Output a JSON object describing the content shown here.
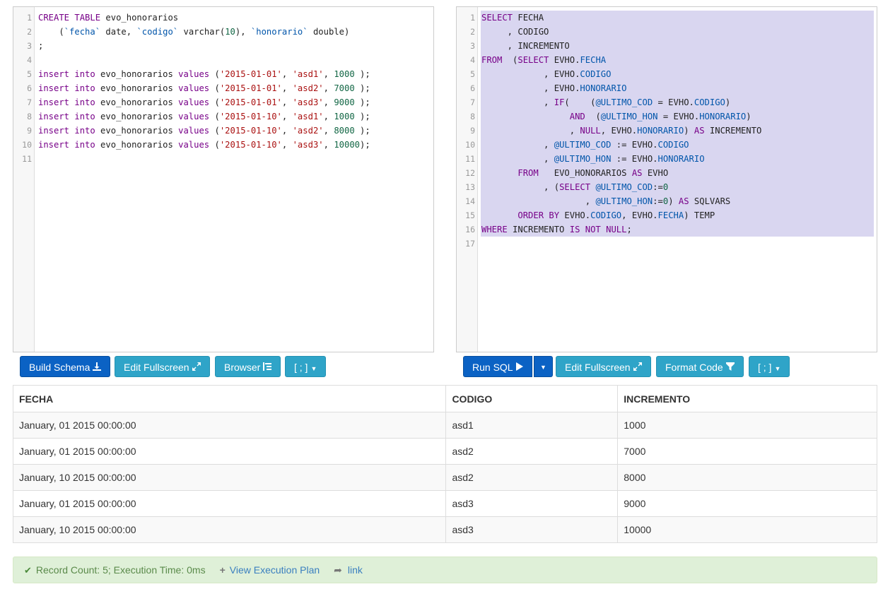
{
  "schema_editor": {
    "lines": [
      [
        {
          "t": "CREATE TABLE ",
          "c": "kw"
        },
        {
          "t": "evo_honorarios",
          "c": "plain"
        }
      ],
      [
        {
          "t": "    (",
          "c": "plain"
        },
        {
          "t": "`fecha`",
          "c": "bq"
        },
        {
          "t": " date, ",
          "c": "plain"
        },
        {
          "t": "`codigo`",
          "c": "bq"
        },
        {
          "t": " varchar(",
          "c": "plain"
        },
        {
          "t": "10",
          "c": "num"
        },
        {
          "t": "), ",
          "c": "plain"
        },
        {
          "t": "`honorario`",
          "c": "bq"
        },
        {
          "t": " double)",
          "c": "plain"
        }
      ],
      [
        {
          "t": ";",
          "c": "plain"
        }
      ],
      [],
      [
        {
          "t": "insert into",
          "c": "kw"
        },
        {
          "t": " evo_honorarios ",
          "c": "plain"
        },
        {
          "t": "values",
          "c": "kw"
        },
        {
          "t": " (",
          "c": "plain"
        },
        {
          "t": "'2015-01-01'",
          "c": "str"
        },
        {
          "t": ", ",
          "c": "plain"
        },
        {
          "t": "'asd1'",
          "c": "str"
        },
        {
          "t": ", ",
          "c": "plain"
        },
        {
          "t": "1000",
          "c": "num"
        },
        {
          "t": " );",
          "c": "plain"
        }
      ],
      [
        {
          "t": "insert into",
          "c": "kw"
        },
        {
          "t": " evo_honorarios ",
          "c": "plain"
        },
        {
          "t": "values",
          "c": "kw"
        },
        {
          "t": " (",
          "c": "plain"
        },
        {
          "t": "'2015-01-01'",
          "c": "str"
        },
        {
          "t": ", ",
          "c": "plain"
        },
        {
          "t": "'asd2'",
          "c": "str"
        },
        {
          "t": ", ",
          "c": "plain"
        },
        {
          "t": "7000",
          "c": "num"
        },
        {
          "t": " );",
          "c": "plain"
        }
      ],
      [
        {
          "t": "insert into",
          "c": "kw"
        },
        {
          "t": " evo_honorarios ",
          "c": "plain"
        },
        {
          "t": "values",
          "c": "kw"
        },
        {
          "t": " (",
          "c": "plain"
        },
        {
          "t": "'2015-01-01'",
          "c": "str"
        },
        {
          "t": ", ",
          "c": "plain"
        },
        {
          "t": "'asd3'",
          "c": "str"
        },
        {
          "t": ", ",
          "c": "plain"
        },
        {
          "t": "9000",
          "c": "num"
        },
        {
          "t": " );",
          "c": "plain"
        }
      ],
      [
        {
          "t": "insert into",
          "c": "kw"
        },
        {
          "t": " evo_honorarios ",
          "c": "plain"
        },
        {
          "t": "values",
          "c": "kw"
        },
        {
          "t": " (",
          "c": "plain"
        },
        {
          "t": "'2015-01-10'",
          "c": "str"
        },
        {
          "t": ", ",
          "c": "plain"
        },
        {
          "t": "'asd1'",
          "c": "str"
        },
        {
          "t": ", ",
          "c": "plain"
        },
        {
          "t": "1000",
          "c": "num"
        },
        {
          "t": " );",
          "c": "plain"
        }
      ],
      [
        {
          "t": "insert into",
          "c": "kw"
        },
        {
          "t": " evo_honorarios ",
          "c": "plain"
        },
        {
          "t": "values",
          "c": "kw"
        },
        {
          "t": " (",
          "c": "plain"
        },
        {
          "t": "'2015-01-10'",
          "c": "str"
        },
        {
          "t": ", ",
          "c": "plain"
        },
        {
          "t": "'asd2'",
          "c": "str"
        },
        {
          "t": ", ",
          "c": "plain"
        },
        {
          "t": "8000",
          "c": "num"
        },
        {
          "t": " );",
          "c": "plain"
        }
      ],
      [
        {
          "t": "insert into",
          "c": "kw"
        },
        {
          "t": " evo_honorarios ",
          "c": "plain"
        },
        {
          "t": "values",
          "c": "kw"
        },
        {
          "t": " (",
          "c": "plain"
        },
        {
          "t": "'2015-01-10'",
          "c": "str"
        },
        {
          "t": ", ",
          "c": "plain"
        },
        {
          "t": "'asd3'",
          "c": "str"
        },
        {
          "t": ", ",
          "c": "plain"
        },
        {
          "t": "10000",
          "c": "num"
        },
        {
          "t": ");",
          "c": "plain"
        }
      ],
      []
    ]
  },
  "query_editor": {
    "selected_lines": 16,
    "lines": [
      [
        {
          "t": "SELECT",
          "c": "kw"
        },
        {
          "t": " FECHA",
          "c": "plain"
        }
      ],
      [
        {
          "t": "     , CODIGO",
          "c": "plain"
        }
      ],
      [
        {
          "t": "     , INCREMENTO",
          "c": "plain"
        }
      ],
      [
        {
          "t": "FROM",
          "c": "kw"
        },
        {
          "t": "  (",
          "c": "plain"
        },
        {
          "t": "SELECT",
          "c": "kw"
        },
        {
          "t": " EVHO.",
          "c": "plain"
        },
        {
          "t": "FECHA",
          "c": "prop"
        }
      ],
      [
        {
          "t": "            , EVHO.",
          "c": "plain"
        },
        {
          "t": "CODIGO",
          "c": "prop"
        }
      ],
      [
        {
          "t": "            , EVHO.",
          "c": "plain"
        },
        {
          "t": "HONORARIO",
          "c": "prop"
        }
      ],
      [
        {
          "t": "            , ",
          "c": "plain"
        },
        {
          "t": "IF",
          "c": "kw"
        },
        {
          "t": "(    (",
          "c": "plain"
        },
        {
          "t": "@ULTIMO_COD",
          "c": "var"
        },
        {
          "t": " = EVHO.",
          "c": "plain"
        },
        {
          "t": "CODIGO",
          "c": "prop"
        },
        {
          "t": ")",
          "c": "plain"
        }
      ],
      [
        {
          "t": "                 ",
          "c": "plain"
        },
        {
          "t": "AND",
          "c": "kw"
        },
        {
          "t": "  (",
          "c": "plain"
        },
        {
          "t": "@ULTIMO_HON",
          "c": "var"
        },
        {
          "t": " = EVHO.",
          "c": "plain"
        },
        {
          "t": "HONORARIO",
          "c": "prop"
        },
        {
          "t": ")",
          "c": "plain"
        }
      ],
      [
        {
          "t": "                 , ",
          "c": "plain"
        },
        {
          "t": "NULL",
          "c": "kw"
        },
        {
          "t": ", EVHO.",
          "c": "plain"
        },
        {
          "t": "HONORARIO",
          "c": "prop"
        },
        {
          "t": ") ",
          "c": "plain"
        },
        {
          "t": "AS",
          "c": "kw"
        },
        {
          "t": " INCREMENTO",
          "c": "plain"
        }
      ],
      [
        {
          "t": "            , ",
          "c": "plain"
        },
        {
          "t": "@ULTIMO_COD",
          "c": "var"
        },
        {
          "t": " := EVHO.",
          "c": "plain"
        },
        {
          "t": "CODIGO",
          "c": "prop"
        }
      ],
      [
        {
          "t": "            , ",
          "c": "plain"
        },
        {
          "t": "@ULTIMO_HON",
          "c": "var"
        },
        {
          "t": " := EVHO.",
          "c": "plain"
        },
        {
          "t": "HONORARIO",
          "c": "prop"
        }
      ],
      [
        {
          "t": "       ",
          "c": "plain"
        },
        {
          "t": "FROM",
          "c": "kw"
        },
        {
          "t": "   EVO_HONORARIOS ",
          "c": "plain"
        },
        {
          "t": "AS",
          "c": "kw"
        },
        {
          "t": " EVHO",
          "c": "plain"
        }
      ],
      [
        {
          "t": "            , (",
          "c": "plain"
        },
        {
          "t": "SELECT",
          "c": "kw"
        },
        {
          "t": " ",
          "c": "plain"
        },
        {
          "t": "@ULTIMO_COD",
          "c": "var"
        },
        {
          "t": ":=",
          "c": "plain"
        },
        {
          "t": "0",
          "c": "num"
        }
      ],
      [
        {
          "t": "                    , ",
          "c": "plain"
        },
        {
          "t": "@ULTIMO_HON",
          "c": "var"
        },
        {
          "t": ":=",
          "c": "plain"
        },
        {
          "t": "0",
          "c": "num"
        },
        {
          "t": ") ",
          "c": "plain"
        },
        {
          "t": "AS",
          "c": "kw"
        },
        {
          "t": " SQLVARS",
          "c": "plain"
        }
      ],
      [
        {
          "t": "       ",
          "c": "plain"
        },
        {
          "t": "ORDER BY",
          "c": "kw"
        },
        {
          "t": " EVHO.",
          "c": "plain"
        },
        {
          "t": "CODIGO",
          "c": "prop"
        },
        {
          "t": ", EVHO.",
          "c": "plain"
        },
        {
          "t": "FECHA",
          "c": "prop"
        },
        {
          "t": ") TEMP",
          "c": "plain"
        }
      ],
      [
        {
          "t": "WHERE",
          "c": "kw"
        },
        {
          "t": " INCREMENTO ",
          "c": "plain"
        },
        {
          "t": "IS NOT NULL",
          "c": "kw"
        },
        {
          "t": ";",
          "c": "plain"
        }
      ],
      []
    ]
  },
  "toolbar_left": {
    "build_schema": "Build Schema",
    "edit_fullscreen": "Edit Fullscreen",
    "browser": "Browser",
    "delimiter": "[ ; ]"
  },
  "toolbar_right": {
    "run_sql": "Run SQL",
    "edit_fullscreen": "Edit Fullscreen",
    "format_code": "Format Code",
    "delimiter": "[ ; ]"
  },
  "results": {
    "columns": [
      "FECHA",
      "CODIGO",
      "INCREMENTO"
    ],
    "rows": [
      [
        "January, 01 2015 00:00:00",
        "asd1",
        "1000"
      ],
      [
        "January, 01 2015 00:00:00",
        "asd2",
        "7000"
      ],
      [
        "January, 10 2015 00:00:00",
        "asd2",
        "8000"
      ],
      [
        "January, 01 2015 00:00:00",
        "asd3",
        "9000"
      ],
      [
        "January, 10 2015 00:00:00",
        "asd3",
        "10000"
      ]
    ]
  },
  "status": {
    "record_info": "Record Count: 5; Execution Time: 0ms",
    "view_plan": "View Execution Plan",
    "link": "link"
  },
  "colors": {
    "primary": "#0b62c4",
    "info": "#2fa4c8",
    "selection": "#d9d6f0",
    "success_bg": "#dff0d8"
  }
}
